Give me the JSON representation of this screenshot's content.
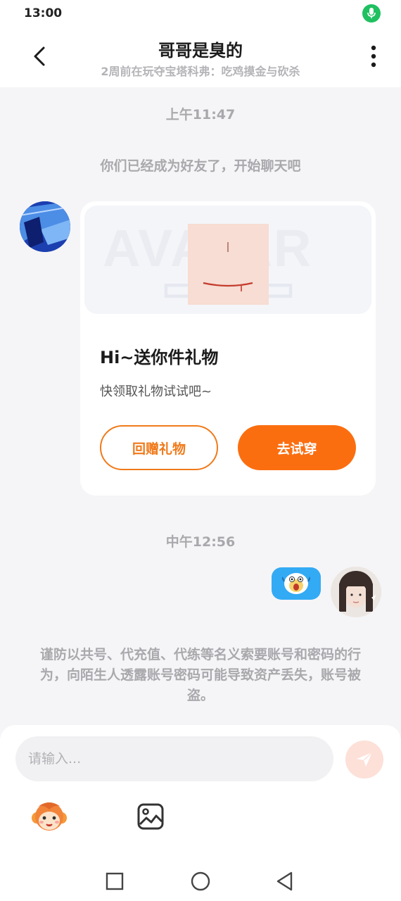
{
  "status_bar": {
    "time": "13:00"
  },
  "header": {
    "title": "哥哥是臭的",
    "subtitle": "2周前在玩夺宝塔科弗：吃鸡摸金与砍杀"
  },
  "chat": {
    "timestamp_1": "上午11:47",
    "system_friend_msg": "你们已经成为好友了，开始聊天吧",
    "gift_card": {
      "banner_watermark": "AVATAR",
      "title": "Hi~送你件礼物",
      "description": "快领取礼物试试吧~",
      "return_gift_label": "回赠礼物",
      "try_on_label": "去试穿"
    },
    "timestamp_2": "中午12:56",
    "warning_text": "谨防以共号、代充值、代练等名义索要账号和密码的行为，向陌生人透露账号密码可能导致资产丢失，账号被盗。"
  },
  "input": {
    "placeholder": "请输入..."
  },
  "colors": {
    "accent_orange": "#fb6e10",
    "bubble_blue": "#33aaf4",
    "mic_green": "#1fc060"
  }
}
